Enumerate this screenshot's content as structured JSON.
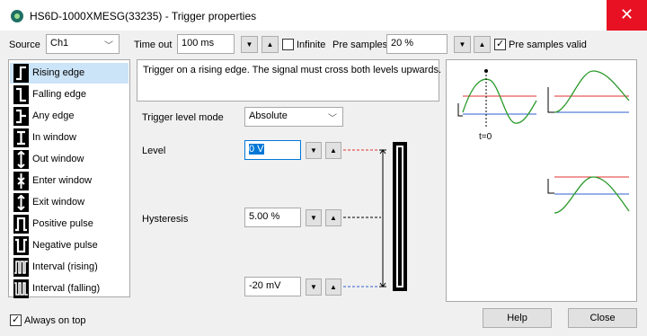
{
  "window": {
    "title": "HS6D-1000XMESG(33235) - Trigger properties",
    "close_glyph": "✕"
  },
  "toolbar": {
    "source_label": "Source",
    "source_value": "Ch1",
    "timeout_label": "Time out",
    "timeout_value": "100 ms",
    "infinite_label": "Infinite",
    "infinite_checked": false,
    "presamples_label": "Pre samples",
    "presamples_value": "20 %",
    "presamples_valid_label": "Pre samples valid",
    "presamples_valid_checked": true,
    "down_glyph": "▼",
    "up_glyph": "▲"
  },
  "trigger_kinds": [
    {
      "label": "Rising edge",
      "icon": "rising-edge-icon",
      "selected": true
    },
    {
      "label": "Falling edge",
      "icon": "falling-edge-icon"
    },
    {
      "label": "Any edge",
      "icon": "any-edge-icon"
    },
    {
      "label": "In window",
      "icon": "in-window-icon"
    },
    {
      "label": "Out window",
      "icon": "out-window-icon"
    },
    {
      "label": "Enter window",
      "icon": "enter-window-icon"
    },
    {
      "label": "Exit window",
      "icon": "exit-window-icon"
    },
    {
      "label": "Positive pulse",
      "icon": "positive-pulse-icon"
    },
    {
      "label": "Negative pulse",
      "icon": "negative-pulse-icon"
    },
    {
      "label": "Interval (rising)",
      "icon": "interval-rising-icon"
    },
    {
      "label": "Interval (falling)",
      "icon": "interval-falling-icon"
    }
  ],
  "description": "Trigger on a rising edge. The signal must cross both levels upwards.",
  "settings": {
    "level_mode_label": "Trigger level mode",
    "level_mode_value": "Absolute",
    "level_label": "Level",
    "level_value": "0 V",
    "hysteresis_label": "Hysteresis",
    "hysteresis_value": "5.00 %",
    "lower_value": "-20 mV"
  },
  "preview": {
    "time_marker": "t=0"
  },
  "footer": {
    "always_on_top_label": "Always on top",
    "always_on_top_checked": true,
    "help_label": "Help",
    "close_label": "Close"
  },
  "colors": {
    "close_bg": "#e81123",
    "selection": "#cce4f7",
    "level_line": "#e03030",
    "lower_line": "#2f5fd0",
    "signal": "#2a9a2a"
  }
}
